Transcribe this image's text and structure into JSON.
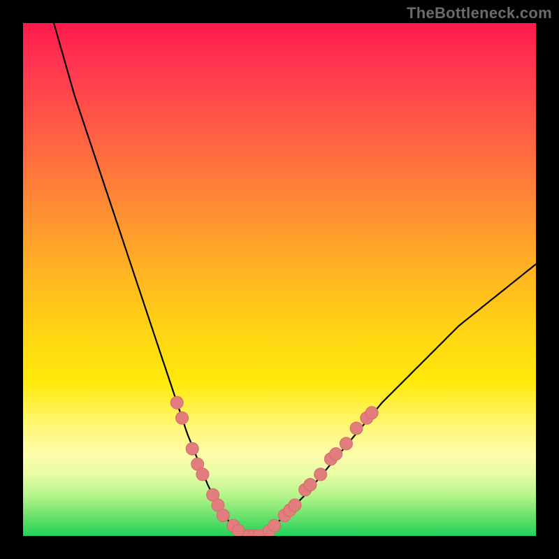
{
  "watermark": "TheBottleneck.com",
  "colors": {
    "curve_stroke": "#000000",
    "marker_fill": "#e27d7d",
    "marker_stroke": "#d46a6a",
    "gradient_stops": [
      "#ff1a4d",
      "#ff3550",
      "#ff5a46",
      "#ff7a3a",
      "#ff992e",
      "#ffb820",
      "#ffd414",
      "#ffe90c",
      "#fff66f",
      "#fdfdac",
      "#e8fca6",
      "#b7f58c",
      "#6ee26e",
      "#1fd15a"
    ]
  },
  "chart_data": {
    "type": "line",
    "title": "",
    "xlabel": "",
    "ylabel": "",
    "xlim": [
      0,
      100
    ],
    "ylim": [
      0,
      100
    ],
    "series": [
      {
        "name": "bottleneck-curve",
        "x": [
          6,
          8,
          10,
          12,
          14,
          16,
          18,
          20,
          22,
          24,
          26,
          28,
          30,
          32,
          34,
          36,
          38,
          40,
          42,
          44,
          46,
          48,
          50,
          55,
          60,
          65,
          70,
          75,
          80,
          85,
          90,
          95,
          100
        ],
        "y": [
          100,
          93,
          86,
          80,
          74,
          68,
          62,
          56,
          50,
          44,
          38,
          32,
          26,
          20,
          15,
          10,
          6,
          3,
          1,
          0,
          0,
          1,
          3,
          8,
          14,
          20,
          26,
          31,
          36,
          41,
          45,
          49,
          53
        ]
      }
    ],
    "markers": {
      "name": "highlight-points",
      "points": [
        {
          "x": 30,
          "y": 26
        },
        {
          "x": 31,
          "y": 23
        },
        {
          "x": 33,
          "y": 17
        },
        {
          "x": 34,
          "y": 14
        },
        {
          "x": 35,
          "y": 12
        },
        {
          "x": 37,
          "y": 8
        },
        {
          "x": 38,
          "y": 6
        },
        {
          "x": 39,
          "y": 4
        },
        {
          "x": 41,
          "y": 2
        },
        {
          "x": 42,
          "y": 1
        },
        {
          "x": 44,
          "y": 0
        },
        {
          "x": 45,
          "y": 0
        },
        {
          "x": 46,
          "y": 0
        },
        {
          "x": 48,
          "y": 1
        },
        {
          "x": 49,
          "y": 2
        },
        {
          "x": 51,
          "y": 4
        },
        {
          "x": 52,
          "y": 5
        },
        {
          "x": 53,
          "y": 6
        },
        {
          "x": 55,
          "y": 9
        },
        {
          "x": 56,
          "y": 10
        },
        {
          "x": 58,
          "y": 12
        },
        {
          "x": 60,
          "y": 15
        },
        {
          "x": 61,
          "y": 16
        },
        {
          "x": 63,
          "y": 18
        },
        {
          "x": 65,
          "y": 21
        },
        {
          "x": 67,
          "y": 23
        },
        {
          "x": 68,
          "y": 24
        }
      ]
    }
  }
}
